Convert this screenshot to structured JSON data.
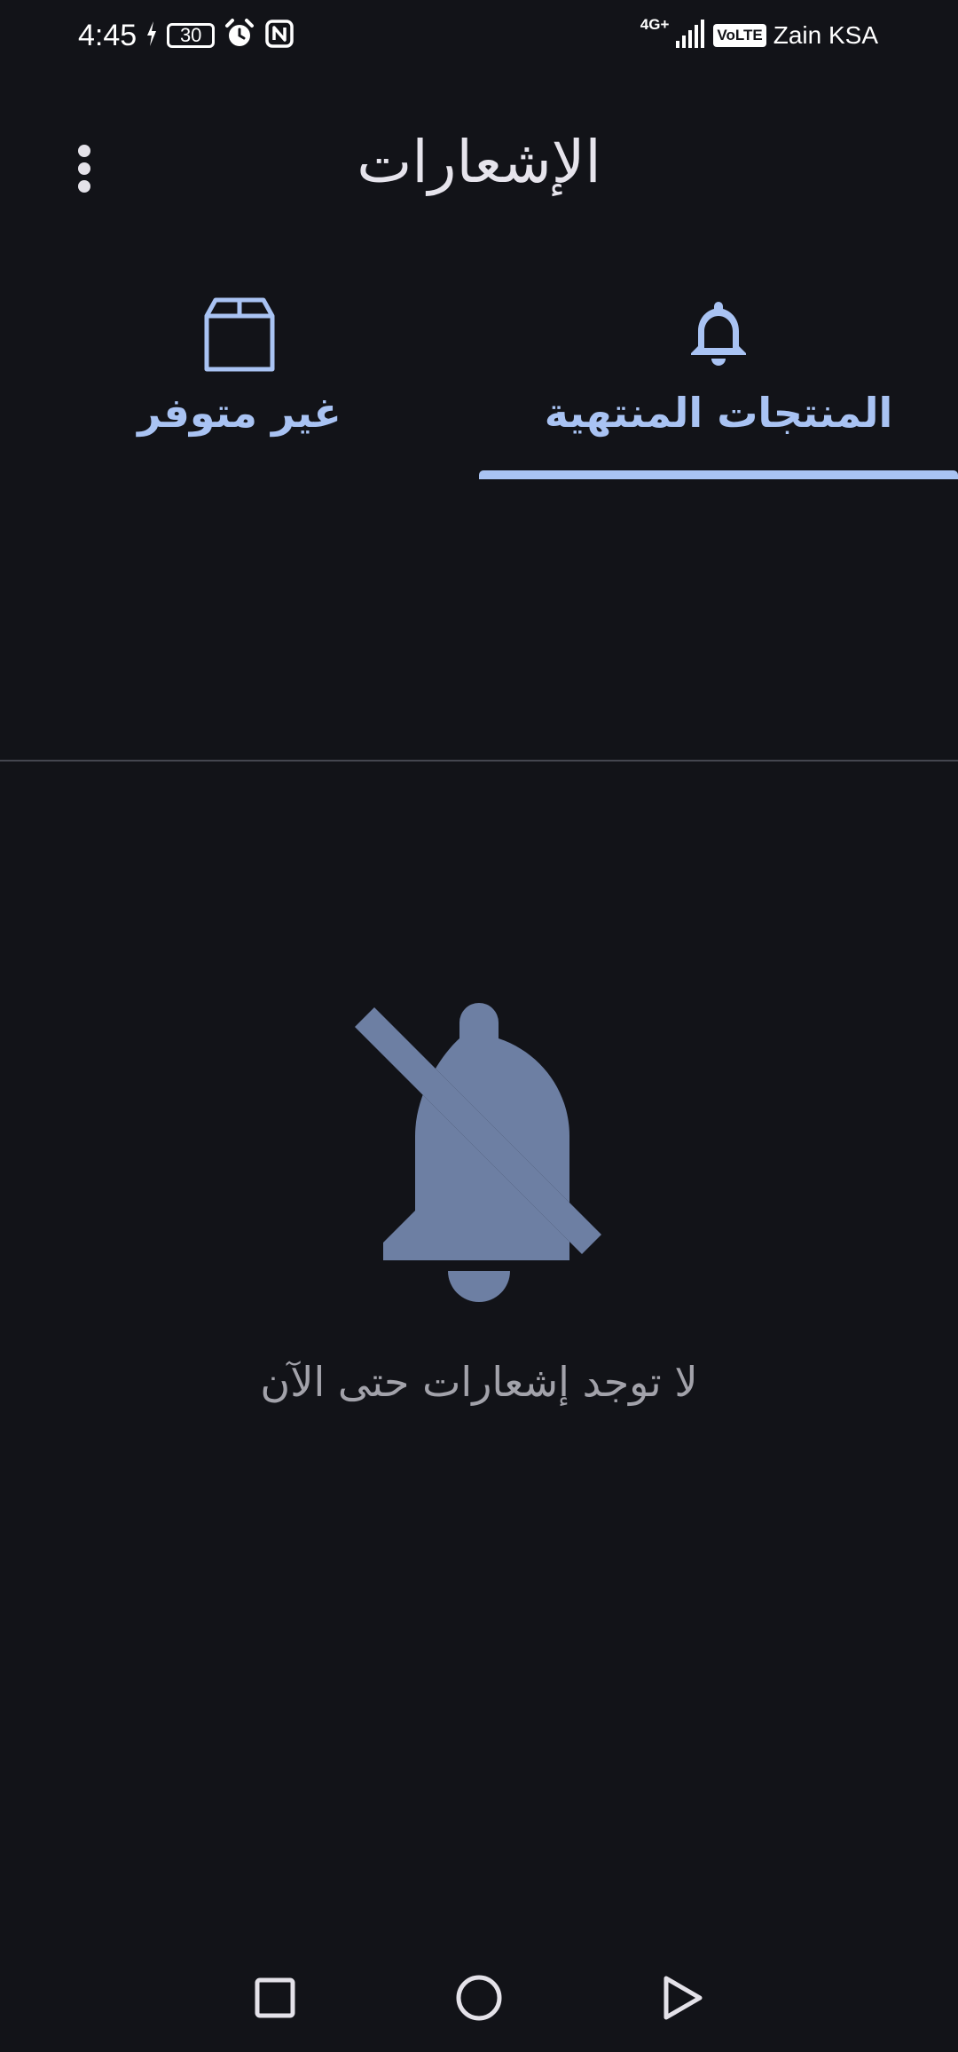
{
  "status_bar": {
    "time": "4:45",
    "battery_level": "30",
    "network_type": "4G+",
    "volte": "VoLTE",
    "carrier": "Zain KSA"
  },
  "app_bar": {
    "title": "الإشعارات",
    "menu_icon": "more-vert-icon"
  },
  "tabs": [
    {
      "label": "المنتجات المنتهية",
      "icon": "bell-icon",
      "selected": true
    },
    {
      "label": "غير متوفر",
      "icon": "box-icon",
      "selected": false
    }
  ],
  "empty_state": {
    "icon": "notifications-off-icon",
    "message": "لا توجد إشعارات حتى الآن"
  },
  "nav_bar": {
    "buttons": [
      "recents-square-icon",
      "home-circle-icon",
      "back-triangle-icon"
    ]
  },
  "colors": {
    "background": "#121318",
    "accent": "#a9c3f3",
    "muted_icon": "#6d7fa3",
    "muted_text": "#a2a2aa"
  }
}
